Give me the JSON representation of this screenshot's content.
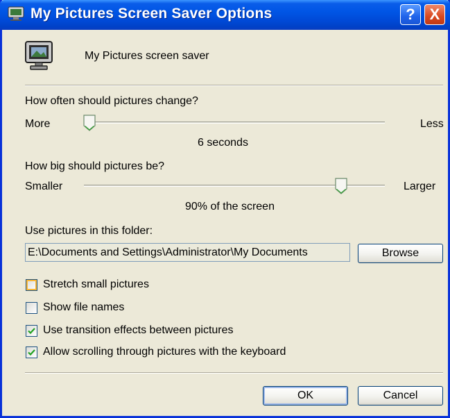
{
  "window": {
    "title": "My Pictures Screen Saver Options",
    "help_button": "?",
    "close_button": "X"
  },
  "header": {
    "icon": "monitor-icon",
    "label": "My Pictures screen saver"
  },
  "change_interval": {
    "question": "How often should pictures change?",
    "min_label": "More",
    "max_label": "Less",
    "value_label": "6 seconds",
    "slider_level": 0.02
  },
  "picture_size": {
    "question": "How big should pictures be?",
    "min_label": "Smaller",
    "max_label": "Larger",
    "value_label": "90% of the screen",
    "slider_level": 0.85
  },
  "folder": {
    "label": "Use pictures in this folder:",
    "path": "E:\\Documents and Settings\\Administrator\\My Documents",
    "browse_label": "Browse"
  },
  "options": [
    {
      "label": "Stretch small pictures",
      "checked": false
    },
    {
      "label": "Show file names",
      "checked": false
    },
    {
      "label": "Use transition effects between pictures",
      "checked": true
    },
    {
      "label": "Allow scrolling through pictures with the keyboard",
      "checked": true
    }
  ],
  "footer": {
    "ok_label": "OK",
    "cancel_label": "Cancel"
  },
  "colors": {
    "titlebar": "#0055e5",
    "dialog_bg": "#ece9d8",
    "close_button": "#d8481f",
    "check_mark": "#21a121"
  }
}
